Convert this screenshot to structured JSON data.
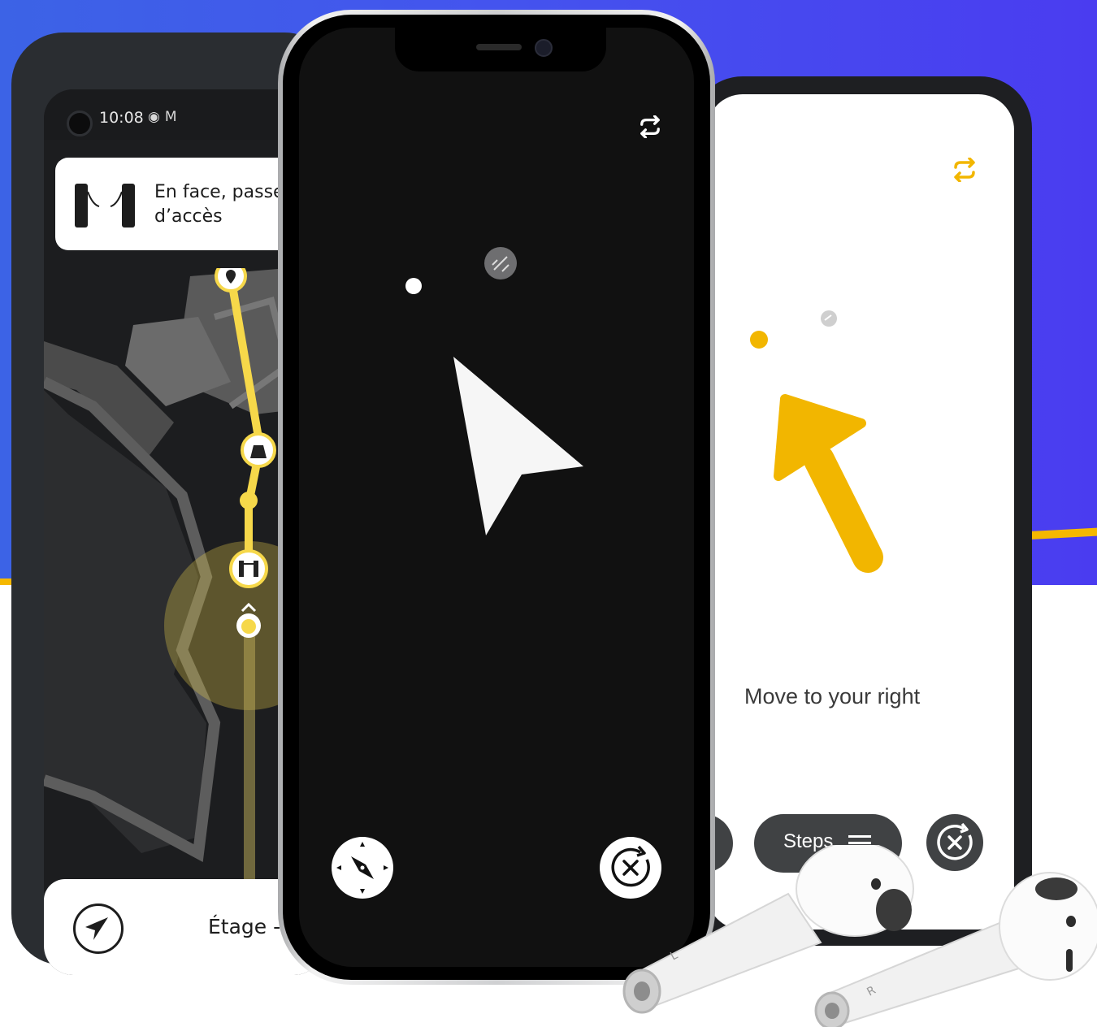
{
  "colors": {
    "background_blue": "#4454ee",
    "accent_yellow": "#f2b600",
    "route_yellow": "#f6d84a",
    "dark_surface": "#111111",
    "pill_gray": "#404244"
  },
  "left_phone": {
    "status_bar": {
      "time": "10:08",
      "icons": [
        "radio-icon",
        "gmail-icon"
      ]
    },
    "banner": {
      "icon": "turnstile-gate-icon",
      "text_line1": "En face, passez",
      "text_line2": "d’accès"
    },
    "map": {
      "markers": [
        "pin-marker-icon",
        "escalator-marker-icon",
        "gate-marker-icon",
        "user-position-icon"
      ]
    },
    "bottom_bar": {
      "locate_icon": "navigation-arrow-icon",
      "floor_label": "Étage -1"
    }
  },
  "center_phone": {
    "top_icon": "swap-icon",
    "compass_button_icon": "compass-icon",
    "close_button_icon": "close-reroute-icon",
    "arrow_icon": "direction-pointer-icon"
  },
  "right_phone": {
    "top_icon": "swap-icon",
    "arrow_icon": "direction-arrow-icon",
    "instruction": "Move to your right",
    "steps_button_label": "Steps",
    "steps_button_icon": "list-icon",
    "close_button_icon": "close-reroute-icon"
  },
  "airpods": {
    "left_label": "L",
    "right_label": "R"
  }
}
